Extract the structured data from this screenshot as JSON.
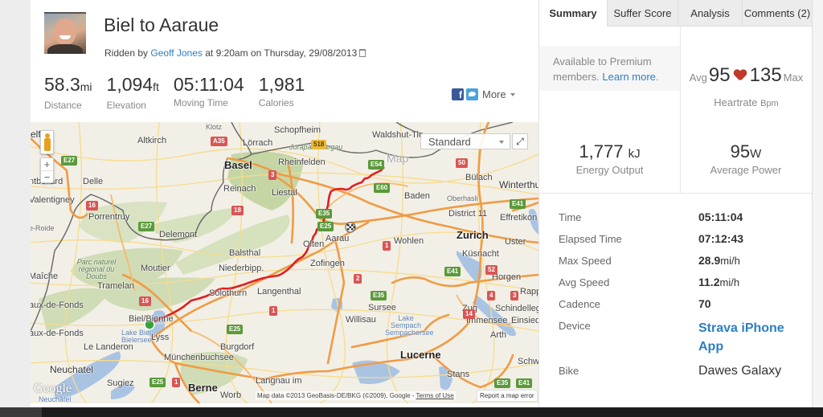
{
  "activity": {
    "title": "Biel to Aaraue",
    "ridden_by_prefix": "Ridden by",
    "athlete": "Geoff Jones",
    "time_of_day_text": "at 9:20am on Thursday, 29/08/2013"
  },
  "stats": [
    {
      "value": "58.3",
      "unit": "mi",
      "label": "Distance"
    },
    {
      "value": "1,094",
      "unit": "ft",
      "label": "Elevation"
    },
    {
      "value": "05:11:04",
      "unit": "",
      "label": "Moving Time"
    },
    {
      "value": "1,981",
      "unit": "",
      "label": "Calories"
    }
  ],
  "share": {
    "facebook": "f",
    "more_label": "More"
  },
  "map": {
    "type_selected": "Standard",
    "fullscreen_glyph": "⤢",
    "zoom_in": "+",
    "zoom_out": "−",
    "google_logo": "Google",
    "attribution": "Map data ©2013 GeoBasis-DE/BKG (©2009), Google -",
    "terms_link": "Terms of Use",
    "report_error": "Report a map error",
    "labels": {
      "belfort": "elfort",
      "altkirch": "Altkirch",
      "lorrach": "Lörrach",
      "schopfheim": "Schopfheim",
      "waldshut": "Waldshut-Tie",
      "basel": "Basel",
      "rheinfelden": "Rheinfelden",
      "reinach": "Reinach",
      "liestal": "Liestal",
      "baden": "Baden",
      "bulach": "Bülach",
      "winterthur": "Winterthur",
      "oberhasli": "Oberhasli",
      "district11": "District 11",
      "effretikon": "Effretikon",
      "delle": "Delle",
      "montbeliard": "ntbeliard",
      "valentigney": "Valentigney",
      "porrentruy": "Porrentruy",
      "roide": "e-Roide",
      "delemont": "Delemont",
      "balsthal": "Balsthal",
      "niederbipp": "Niederbipp.",
      "olten": "Olten",
      "aarau": "Aarau",
      "wohlen": "Wohlen",
      "zurich": "Zurich",
      "uster": "Uster",
      "kusnacht": "Küsnacht",
      "horgen": "Horgen",
      "moutier": "Moutier",
      "zofingen": "Zofingen",
      "tramelan": "Tramelan",
      "solothurn": "Solothurn",
      "langenthal": "Langenthal",
      "maiche": "Maîche",
      "biel": "Biel/Bienne",
      "chauxdefonds": "aux-de-Fonds",
      "lyss": "Lyss",
      "burgdorf": "Burgdorf",
      "leLanderon": "Le Landeron",
      "muchenbuchsee": "Münchenbuchsee",
      "neuchatel": "Neuchatel",
      "sugiez": "Sugiez",
      "berne": "Berne",
      "worb": "Worb",
      "langnau": "Langnau im",
      "sursee": "Sursee",
      "willisau": "Willisau",
      "zug": "Zug",
      "schindellegi": "Schindellegi",
      "immensee": "Immensee",
      "einsiedeln": "Einsiedel",
      "arth": "Arth",
      "lucerne": "Lucerne",
      "schwyz": "Schwyz",
      "stans": "Stans",
      "rapp": "Rapp",
      "klotz": "Klotz",
      "jurapark": "Jurapark Aargau",
      "parc": "Parc naturel régional du Doubs",
      "lakebiel": "Lake Biel Bielersee",
      "lakesempach": "Lake Sempach Sempachersee",
      "neuchatelLake": "Neuchâtel",
      "mapWatermark": "Map"
    },
    "shields": {
      "a35": "A35",
      "s518": "518",
      "e27a": "E27",
      "e54": "E54",
      "e60": "E60",
      "r3a": "3",
      "r50": "50",
      "e41a": "E41",
      "r16a": "16",
      "r18": "18",
      "e35a": "E35",
      "e25a": "E25",
      "e27b": "E27",
      "r1a": "1",
      "r2": "2",
      "e41b": "E41",
      "r4": "4",
      "r52": "52",
      "r3b": "3",
      "r16b": "16",
      "r1b": "1",
      "e25b": "E25",
      "r14": "14",
      "e25c": "E25",
      "r1c": "1",
      "e35b": "E35",
      "e41c": "E41"
    }
  },
  "tabs": [
    {
      "label": "Summary",
      "active": true
    },
    {
      "label": "Suffer Score",
      "active": false
    },
    {
      "label": "Analysis",
      "active": false
    },
    {
      "label": "Comments (2)",
      "active": false
    }
  ],
  "premium": {
    "text": "Available to Premium members.",
    "link": "Learn more",
    "suffix": "."
  },
  "heartrate": {
    "avg_label": "Avg",
    "avg": "95",
    "max": "135",
    "max_label": "Max",
    "label": "Heartrate",
    "unit": "Bpm"
  },
  "energy": {
    "value": "1,777",
    "unit": "kJ",
    "label": "Energy Output"
  },
  "power": {
    "value": "95",
    "unit": "W",
    "label": "Average Power"
  },
  "details": [
    {
      "key": "Time",
      "value": "05:11:04",
      "unit": ""
    },
    {
      "key": "Elapsed Time",
      "value": "07:12:43",
      "unit": ""
    },
    {
      "key": "Max Speed",
      "value": "28.9",
      "unit": "mi/h"
    },
    {
      "key": "Avg Speed",
      "value": "11.2",
      "unit": "mi/h"
    },
    {
      "key": "Cadence",
      "value": "70",
      "unit": ""
    },
    {
      "key": "Device",
      "value": "Strava iPhone App",
      "unit": ""
    },
    {
      "key": "Bike",
      "value": "Dawes Galaxy",
      "unit": ""
    }
  ]
}
